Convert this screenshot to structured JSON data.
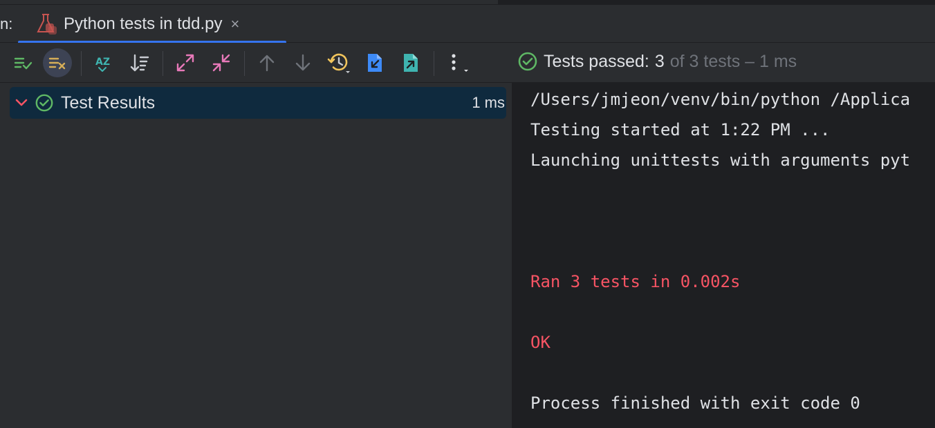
{
  "run_label": "n:",
  "tab": {
    "title": "Python tests in tdd.py",
    "close_glyph": "×"
  },
  "toolbar": {
    "buttons": [
      "show-passed-icon",
      "show-ignored-icon",
      "sort-alphabetically-icon",
      "sort-by-duration-icon",
      "expand-all-icon",
      "collapse-all-icon",
      "previous-failed-icon",
      "next-failed-icon",
      "test-history-icon",
      "import-tests-icon",
      "export-tests-icon",
      "more-options-icon"
    ]
  },
  "status": {
    "label": "Tests passed:",
    "passed": "3",
    "rest": "of 3 tests – 1 ms"
  },
  "tree": {
    "root_label": "Test Results",
    "root_time": "1 ms"
  },
  "console": {
    "lines": [
      "/Users/jmjeon/venv/bin/python /Applica",
      "Testing started at 1:22 PM ...",
      "Launching unittests with arguments pyt",
      "Ran 3 tests in 0.002s",
      "OK",
      "Process finished with exit code 0"
    ]
  },
  "colors": {
    "accent": "#3574f0",
    "success": "#5fb865",
    "error": "#f75464",
    "selection": "#0f2a3e"
  }
}
